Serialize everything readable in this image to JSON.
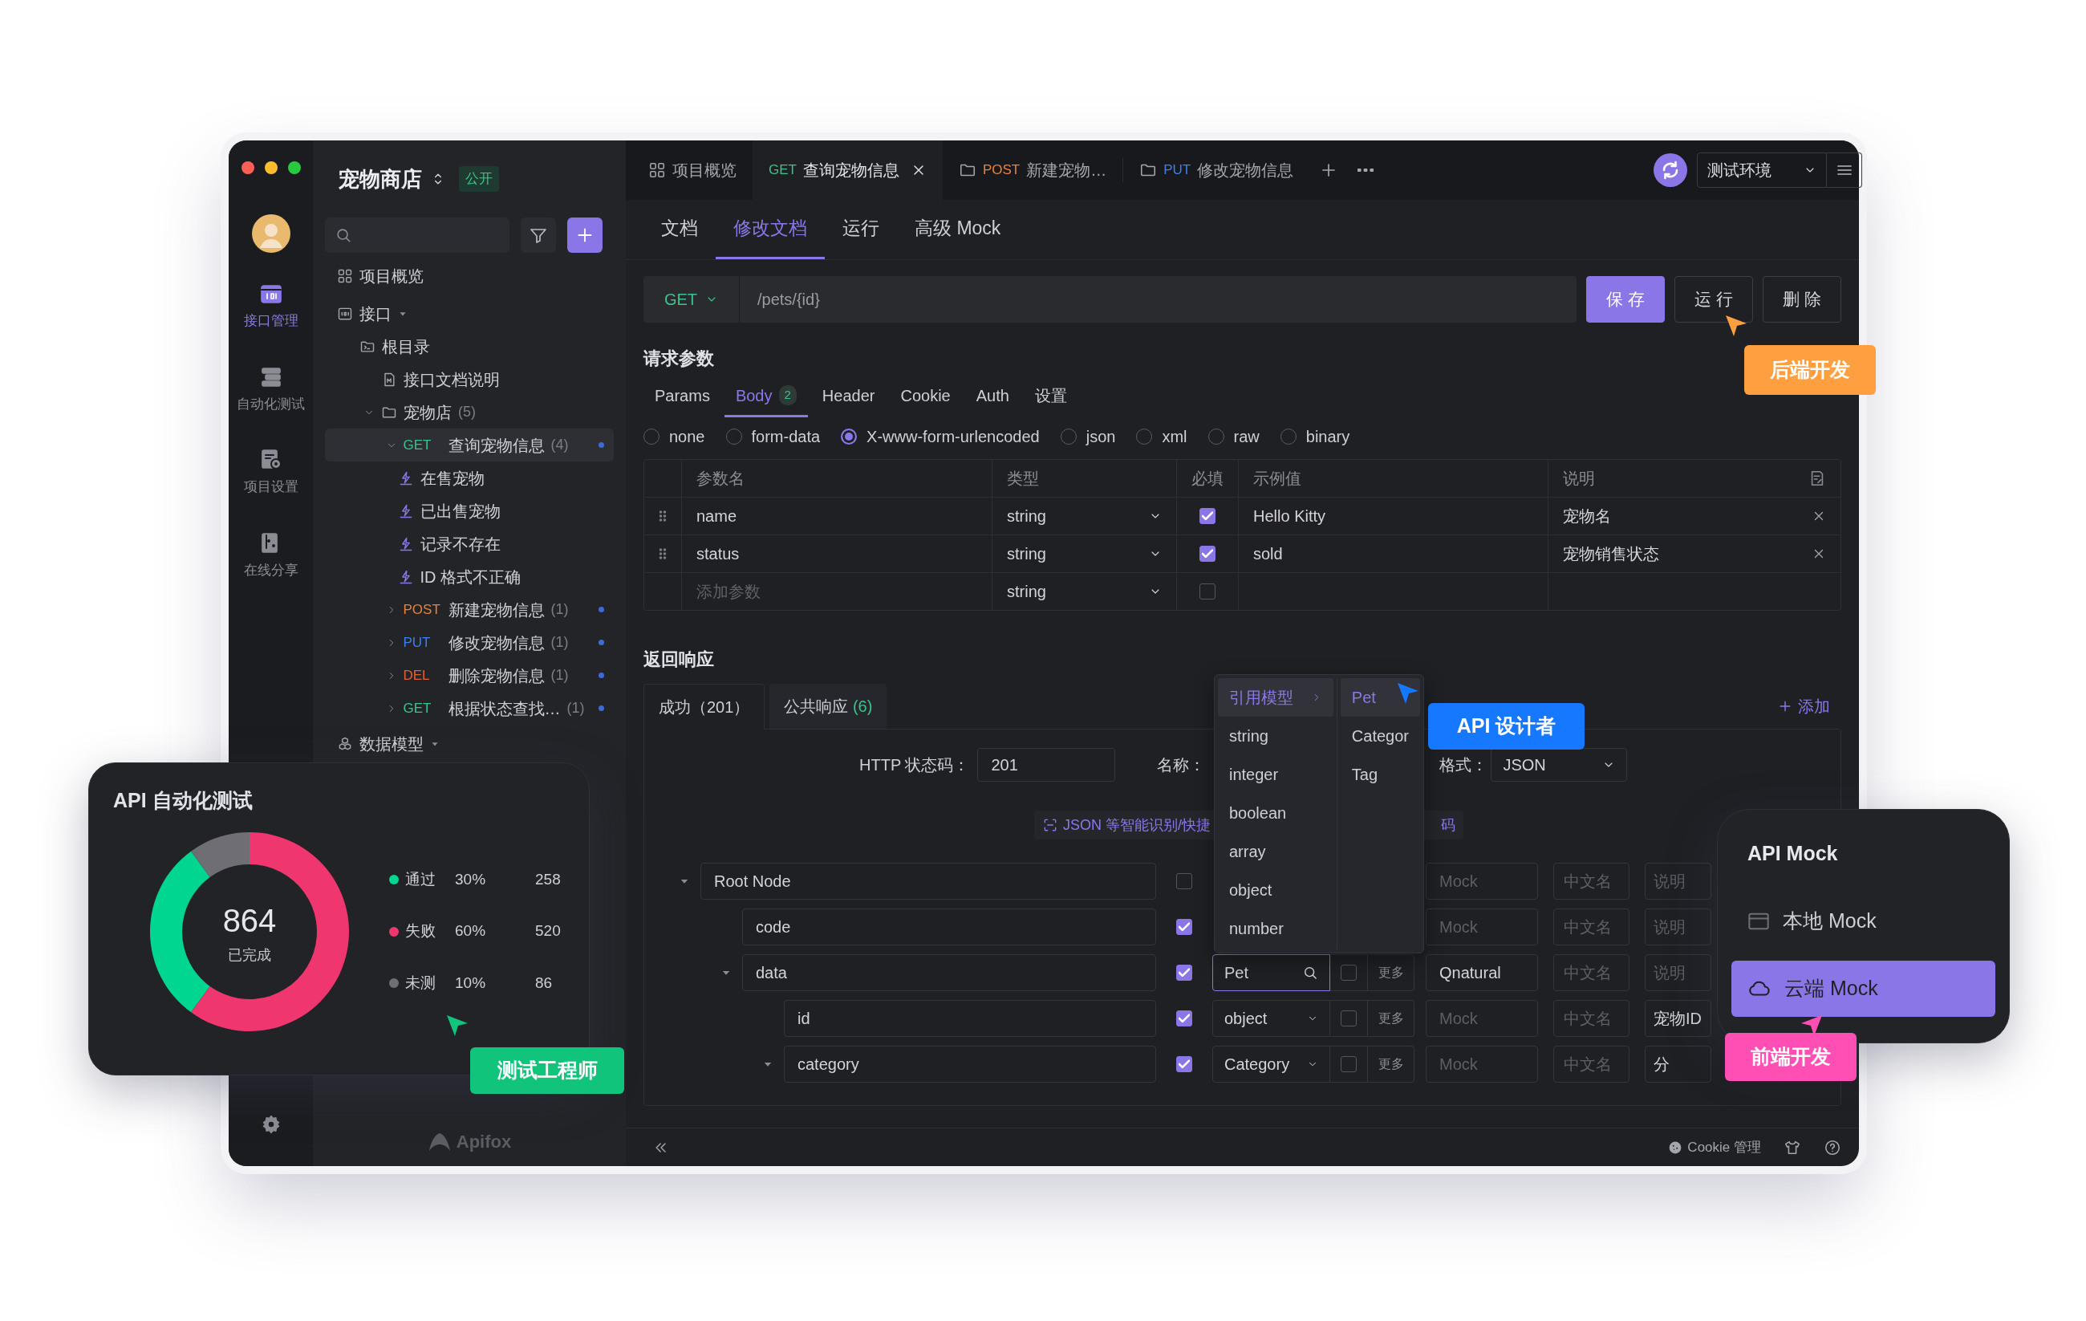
{
  "rail": {
    "items": [
      {
        "kind": "api",
        "label": "接口管理",
        "selected": true
      },
      {
        "kind": "automation",
        "label": "自动化测试",
        "selected": false
      },
      {
        "kind": "settings",
        "label": "项目设置",
        "selected": false
      },
      {
        "kind": "share",
        "label": "在线分享",
        "selected": false
      }
    ]
  },
  "sidebar": {
    "project": "宠物商店",
    "visibility": "公开",
    "logo": "Apifox",
    "tree": [
      {
        "kind": "overview",
        "label": "项目概览"
      },
      {
        "kind": "section",
        "label": "接口",
        "expanded": true,
        "children": [
          {
            "kind": "root",
            "label": "根目录",
            "children": [
              {
                "kind": "doc",
                "label": "接口文档说明"
              },
              {
                "kind": "folder",
                "label": "宠物店",
                "count": "(5)",
                "expanded": true,
                "children": [
                  {
                    "kind": "api",
                    "method": "GET",
                    "label": "查询宠物信息",
                    "count": "(4)",
                    "expanded": true,
                    "selected": true,
                    "children": [
                      {
                        "kind": "case",
                        "label": "在售宠物"
                      },
                      {
                        "kind": "case",
                        "label": "已出售宠物"
                      },
                      {
                        "kind": "case",
                        "label": "记录不存在"
                      },
                      {
                        "kind": "case",
                        "label": "ID 格式不正确"
                      }
                    ]
                  },
                  {
                    "kind": "api",
                    "method": "POST",
                    "label": "新建宠物信息",
                    "count": "(1)",
                    "expanded": false,
                    "selected": false
                  },
                  {
                    "kind": "api",
                    "method": "PUT",
                    "label": "修改宠物信息",
                    "count": "(1)",
                    "expanded": false,
                    "selected": false
                  },
                  {
                    "kind": "api",
                    "method": "DEL",
                    "label": "删除宠物信息",
                    "count": "(1)",
                    "expanded": false,
                    "selected": false
                  },
                  {
                    "kind": "api",
                    "method": "GET",
                    "label": "根据状态查找…",
                    "count": "(1)",
                    "expanded": false,
                    "selected": false
                  }
                ]
              }
            ]
          }
        ]
      },
      {
        "kind": "section",
        "label": "数据模型",
        "expanded": true
      }
    ]
  },
  "tabs": [
    {
      "kind": "overview",
      "label": "项目概览",
      "selected": false,
      "closable": false
    },
    {
      "kind": "api",
      "method": "GET",
      "label": "查询宠物信息",
      "selected": true,
      "closable": true
    },
    {
      "kind": "api",
      "method": "POST",
      "label": "新建宠物…",
      "selected": false,
      "closable": false
    },
    {
      "kind": "api",
      "method": "PUT",
      "label": "修改宠物信息",
      "selected": false,
      "closable": false
    }
  ],
  "environment": "测试环境",
  "doc_tabs": [
    {
      "label": "文档",
      "selected": false
    },
    {
      "label": "修改文档",
      "selected": true
    },
    {
      "label": "运行",
      "selected": false
    },
    {
      "label": "高级 Mock",
      "selected": false
    }
  ],
  "request": {
    "method": "GET",
    "path": "/pets/{id}",
    "buttons": [
      {
        "kind": "primary",
        "label": "保 存"
      },
      {
        "kind": "outline",
        "label": "运 行"
      },
      {
        "kind": "outline",
        "label": "删 除"
      }
    ]
  },
  "params": {
    "title": "请求参数",
    "tabs": [
      {
        "label": "Params",
        "selected": false
      },
      {
        "label": "Body",
        "count": "2",
        "selected": true
      },
      {
        "label": "Header",
        "selected": false
      },
      {
        "label": "Cookie",
        "selected": false
      },
      {
        "label": "Auth",
        "selected": false
      },
      {
        "label": "设置",
        "selected": false
      }
    ],
    "body_types": [
      {
        "label": "none",
        "selected": false
      },
      {
        "label": "form-data",
        "selected": false
      },
      {
        "label": "X-www-form-urlencoded",
        "selected": true
      },
      {
        "label": "json",
        "selected": false
      },
      {
        "label": "xml",
        "selected": false
      },
      {
        "label": "raw",
        "selected": false
      },
      {
        "label": "binary",
        "selected": false
      }
    ],
    "columns": [
      "参数名",
      "类型",
      "必填",
      "示例值",
      "说明"
    ],
    "rows": [
      {
        "name": "name",
        "type": "string",
        "required": true,
        "example": "Hello Kitty",
        "description": "宠物名"
      },
      {
        "name": "status",
        "type": "string",
        "required": true,
        "example": "sold",
        "description": "宠物销售状态"
      }
    ],
    "add_row": {
      "placeholder": "添加参数",
      "type": "string",
      "required": false
    }
  },
  "response": {
    "title": "返回响应",
    "tabs": [
      {
        "label": "成功（201）",
        "selected": true
      },
      {
        "label": "公共响应",
        "count": "(6)",
        "selected": false
      }
    ],
    "add": "添加",
    "status_label": "HTTP 状态码：",
    "status": "201",
    "name_label": "名称：",
    "format_label": "格式：",
    "format": "JSON",
    "hint": "JSON 等智能识别/快捷",
    "hint_tail": "码",
    "schema": [
      {
        "name": "Root Node",
        "expanded": true,
        "required": false,
        "mock": {
          "placeholder": "Mock"
        },
        "title": {
          "placeholder": "中文名"
        },
        "description": {
          "placeholder": "说明"
        },
        "children": [
          {
            "name": "code",
            "required": true,
            "mock": {
              "placeholder": "Mock"
            },
            "title": {
              "placeholder": "中文名"
            },
            "description": {
              "placeholder": "说明"
            }
          },
          {
            "name": "data",
            "expanded": true,
            "required": true,
            "type": {
              "kind": "search",
              "value": "Pet"
            },
            "nullable": false,
            "more": "更多",
            "mock": {
              "value": "Qnatural"
            },
            "title": {
              "placeholder": "中文名"
            },
            "description": {
              "placeholder": "说明"
            },
            "children": [
              {
                "name": "id",
                "required": true,
                "type": {
                  "kind": "select",
                  "value": "object"
                },
                "nullable": false,
                "more": "更多",
                "mock": {
                  "placeholder": "Mock"
                },
                "title": {
                  "placeholder": "中文名"
                },
                "description": {
                  "value": "宠物ID"
                }
              },
              {
                "name": "category",
                "expanded": true,
                "required": true,
                "type": {
                  "kind": "select",
                  "value": "Category"
                },
                "nullable": false,
                "more": "更多",
                "mock": {
                  "placeholder": "Mock"
                },
                "title": {
                  "placeholder": "中文名"
                },
                "description": {
                  "value": "分"
                }
              }
            ]
          }
        ]
      }
    ]
  },
  "type_menu": {
    "items": [
      {
        "label": "引用模型",
        "submenu": true,
        "selected": true
      },
      {
        "label": "string",
        "submenu": false,
        "selected": false
      },
      {
        "label": "integer",
        "submenu": false,
        "selected": false
      },
      {
        "label": "boolean",
        "submenu": false,
        "selected": false
      },
      {
        "label": "array",
        "submenu": false,
        "selected": false
      },
      {
        "label": "object",
        "submenu": false,
        "selected": false
      },
      {
        "label": "number",
        "submenu": false,
        "selected": false
      }
    ],
    "models": [
      {
        "label": "Pet",
        "selected": true
      },
      {
        "label": "Categor",
        "selected": false
      },
      {
        "label": "Tag",
        "selected": false
      }
    ]
  },
  "footer": {
    "cookie": "Cookie 管理"
  },
  "automation": {
    "title": "API 自动化测试",
    "total": "864",
    "total_label": "已完成",
    "legend": [
      {
        "percent": "30%",
        "count": "258",
        "color": "#00d690"
      },
      {
        "percent": "60%",
        "count": "520",
        "color": "#f0366f"
      },
      {
        "percent": "10%",
        "count": "86",
        "color": "#6e6e74"
      }
    ],
    "chart_data": {
      "type": "donut",
      "categories": [
        "通过",
        "失败",
        "未测"
      ],
      "values": [
        30,
        60,
        10
      ]
    }
  },
  "mock_card": {
    "title": "API Mock",
    "items": [
      {
        "kind": "local",
        "label": "本地 Mock",
        "selected": false
      },
      {
        "kind": "cloud",
        "label": "云端 Mock",
        "selected": true
      }
    ]
  },
  "callouts": [
    {
      "kind": "backend",
      "label": "后端开发",
      "color": "#ff9f40"
    },
    {
      "kind": "designer",
      "label": "API 设计者",
      "color": "#1677ff"
    },
    {
      "kind": "tester",
      "label": "测试工程师",
      "color": "#10c47c"
    },
    {
      "kind": "frontend",
      "label": "前端开发",
      "color": "#ff4fb5"
    }
  ]
}
